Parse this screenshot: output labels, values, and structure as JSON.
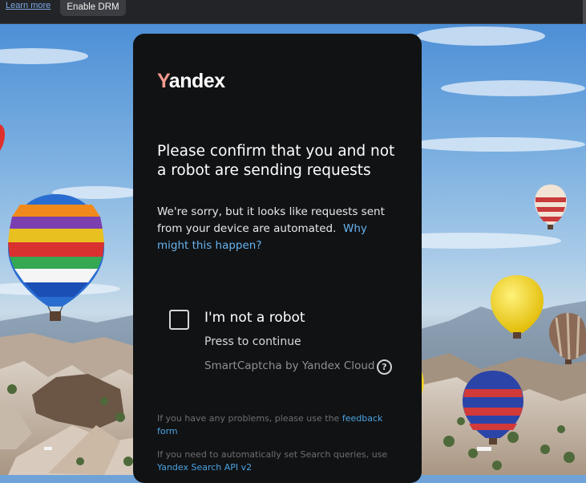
{
  "drm_bar": {
    "learn_more": "Learn more",
    "enable_drm": "Enable DRM"
  },
  "card": {
    "logo_first": "Y",
    "logo_rest": "andex",
    "title": "Please confirm that you and not a robot are sending requests",
    "description": "We're sorry, but it looks like requests sent from your device are automated.",
    "why_link": "Why might this happen?",
    "captcha": {
      "label": "I'm not a robot",
      "sub": "Press to continue",
      "brand": "SmartCaptcha by Yandex Cloud",
      "help_icon": "question-circle-icon",
      "help_glyph": "?"
    },
    "footer1_text": "If you have any problems, please use the ",
    "footer1_link": "feedback form",
    "footer2_text": "If you need to automatically set Search queries, use ",
    "footer2_link": "Yandex Search API v2"
  },
  "colors": {
    "card_bg": "#111214",
    "logo_accent": "#f39a8d",
    "link": "#66b4f0"
  }
}
